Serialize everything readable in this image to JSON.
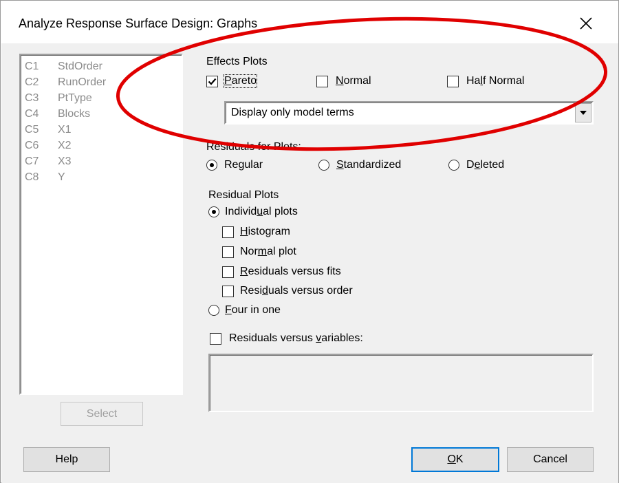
{
  "window": {
    "title": "Analyze Response Surface Design: Graphs"
  },
  "variables": [
    {
      "col": "C1",
      "name": "StdOrder"
    },
    {
      "col": "C2",
      "name": "RunOrder"
    },
    {
      "col": "C3",
      "name": "PtType"
    },
    {
      "col": "C4",
      "name": "Blocks"
    },
    {
      "col": "C5",
      "name": "X1"
    },
    {
      "col": "C6",
      "name": "X2"
    },
    {
      "col": "C7",
      "name": "X3"
    },
    {
      "col": "C8",
      "name": "Y"
    }
  ],
  "select_label": "Select",
  "effects_plots": {
    "heading": "Effects Plots",
    "pareto": {
      "pre": "",
      "key": "P",
      "post": "areto",
      "checked": true
    },
    "normal": {
      "pre": "",
      "key": "N",
      "post": "ormal",
      "checked": false
    },
    "half_normal": {
      "pre": "Ha",
      "key": "l",
      "post": "f Normal",
      "checked": false
    },
    "display_option": "Display only model terms"
  },
  "residuals_for_plots": {
    "heading": "Residuals for Plots:",
    "regular": {
      "pre": "Re",
      "key": "g",
      "post": "ular",
      "selected": true
    },
    "standardized": {
      "pre": "",
      "key": "S",
      "post": "tandardized",
      "selected": false
    },
    "deleted": {
      "pre": "D",
      "key": "e",
      "post": "leted",
      "selected": false
    }
  },
  "residual_plots": {
    "heading": "Residual Plots",
    "individual": {
      "pre": "Individ",
      "key": "u",
      "post": "al plots",
      "selected": true
    },
    "histogram": {
      "pre": "",
      "key": "H",
      "post": "istogram",
      "checked": false
    },
    "normal_plot": {
      "pre": "Nor",
      "key": "m",
      "post": "al plot",
      "checked": false
    },
    "vs_fits": {
      "pre": "",
      "key": "R",
      "post": "esiduals versus fits",
      "checked": false
    },
    "vs_order": {
      "pre": "Resi",
      "key": "d",
      "post": "uals versus order",
      "checked": false
    },
    "four_in_one": {
      "pre": "",
      "key": "F",
      "post": "our in one",
      "selected": false
    }
  },
  "residuals_vs_variables": {
    "pre": "Residuals versus ",
    "key": "v",
    "post": "ariables:",
    "checked": false
  },
  "buttons": {
    "help": "Help",
    "ok_key": "O",
    "ok_post": "K",
    "cancel": "Cancel"
  },
  "colors": {
    "highlight_ellipse": "#e00000",
    "disabled_text": "#8b8b8b"
  }
}
